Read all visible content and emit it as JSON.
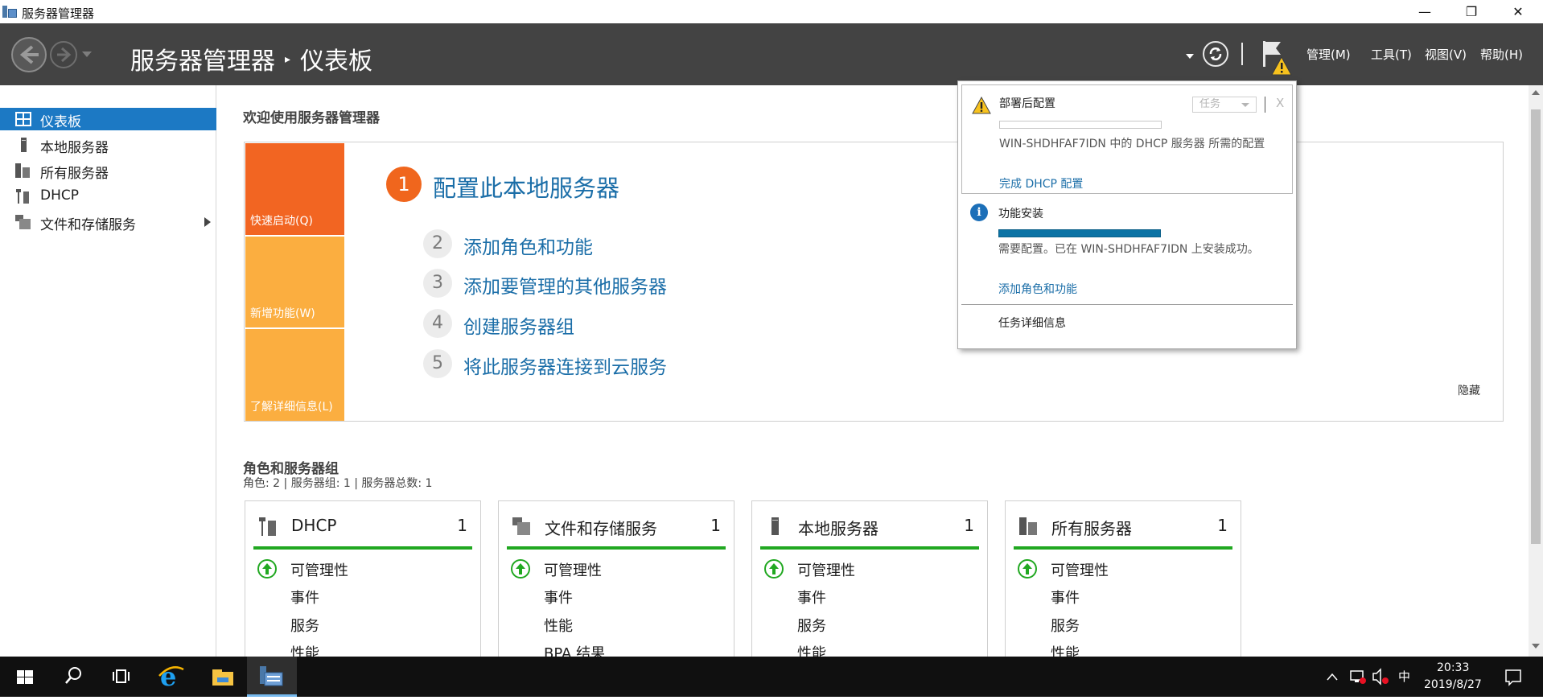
{
  "window": {
    "title": "服务器管理器",
    "controls": {
      "minimize": "—",
      "restore": "❐",
      "close": "✕"
    }
  },
  "header": {
    "breadcrumb_root": "服务器管理器",
    "breadcrumb_sep": "▸",
    "breadcrumb_current": "仪表板",
    "menus": [
      "管理(M)",
      "工具(T)",
      "视图(V)",
      "帮助(H)"
    ]
  },
  "sidebar": {
    "items": [
      {
        "label": "仪表板",
        "icon": "dashboard-icon",
        "active": true
      },
      {
        "label": "本地服务器",
        "icon": "local-server-icon"
      },
      {
        "label": "所有服务器",
        "icon": "all-servers-icon"
      },
      {
        "label": "DHCP",
        "icon": "dhcp-icon"
      },
      {
        "label": "文件和存储服务",
        "icon": "file-storage-icon",
        "has_submenu": true
      }
    ]
  },
  "welcome": {
    "title": "欢迎使用服务器管理器",
    "tiles": [
      {
        "label": "快速启动(Q)",
        "color": "#f26522"
      },
      {
        "label": "新增功能(W)",
        "color": "#fbae40"
      },
      {
        "label": "了解详细信息(L)",
        "color": "#fbae40"
      }
    ],
    "main_step": {
      "num": "1",
      "text": "配置此本地服务器"
    },
    "steps": [
      {
        "num": "2",
        "text": "添加角色和功能"
      },
      {
        "num": "3",
        "text": "添加要管理的其他服务器"
      },
      {
        "num": "4",
        "text": "创建服务器组"
      },
      {
        "num": "5",
        "text": "将此服务器连接到云服务"
      }
    ],
    "hide": "隐藏"
  },
  "roles": {
    "title": "角色和服务器组",
    "subtitle": "角色: 2 | 服务器组: 1 | 服务器总数: 1",
    "cards": [
      {
        "name": "DHCP",
        "count": "1",
        "icon": "dhcp-icon",
        "status": "可管理性",
        "rows": [
          "事件",
          "服务",
          "性能"
        ]
      },
      {
        "name": "文件和存储服务",
        "count": "1",
        "icon": "file-storage-icon",
        "status": "可管理性",
        "rows": [
          "事件",
          "性能",
          "BPA 结果"
        ]
      },
      {
        "name": "本地服务器",
        "count": "1",
        "icon": "local-server-icon",
        "status": "可管理性",
        "rows": [
          "事件",
          "服务",
          "性能"
        ]
      },
      {
        "name": "所有服务器",
        "count": "1",
        "icon": "all-servers-icon",
        "status": "可管理性",
        "rows": [
          "事件",
          "服务",
          "性能"
        ]
      }
    ]
  },
  "notifications": {
    "post_deploy": {
      "title": "部署后配置",
      "task_button": "任务",
      "close": "X",
      "desc": "WIN-SHDHFAF7IDN 中的 DHCP 服务器 所需的配置",
      "link": "完成 DHCP 配置"
    },
    "feature_install": {
      "title": "功能安装",
      "progress": 1.0,
      "desc": "需要配置。已在 WIN-SHDHFAF7IDN 上安装成功。",
      "link": "添加角色和功能"
    },
    "task_details": "任务详细信息"
  },
  "taskbar": {
    "time": "20:33",
    "date": "2019/8/27",
    "ime": "中",
    "apps": [
      "start-icon",
      "search-icon",
      "task-view-icon",
      "ie-icon",
      "file-explorer-icon",
      "server-manager-icon"
    ]
  },
  "colors": {
    "header_bg": "#434343",
    "accent": "#1c79c4",
    "link": "#1b6ea8",
    "status_green": "#21a821"
  }
}
